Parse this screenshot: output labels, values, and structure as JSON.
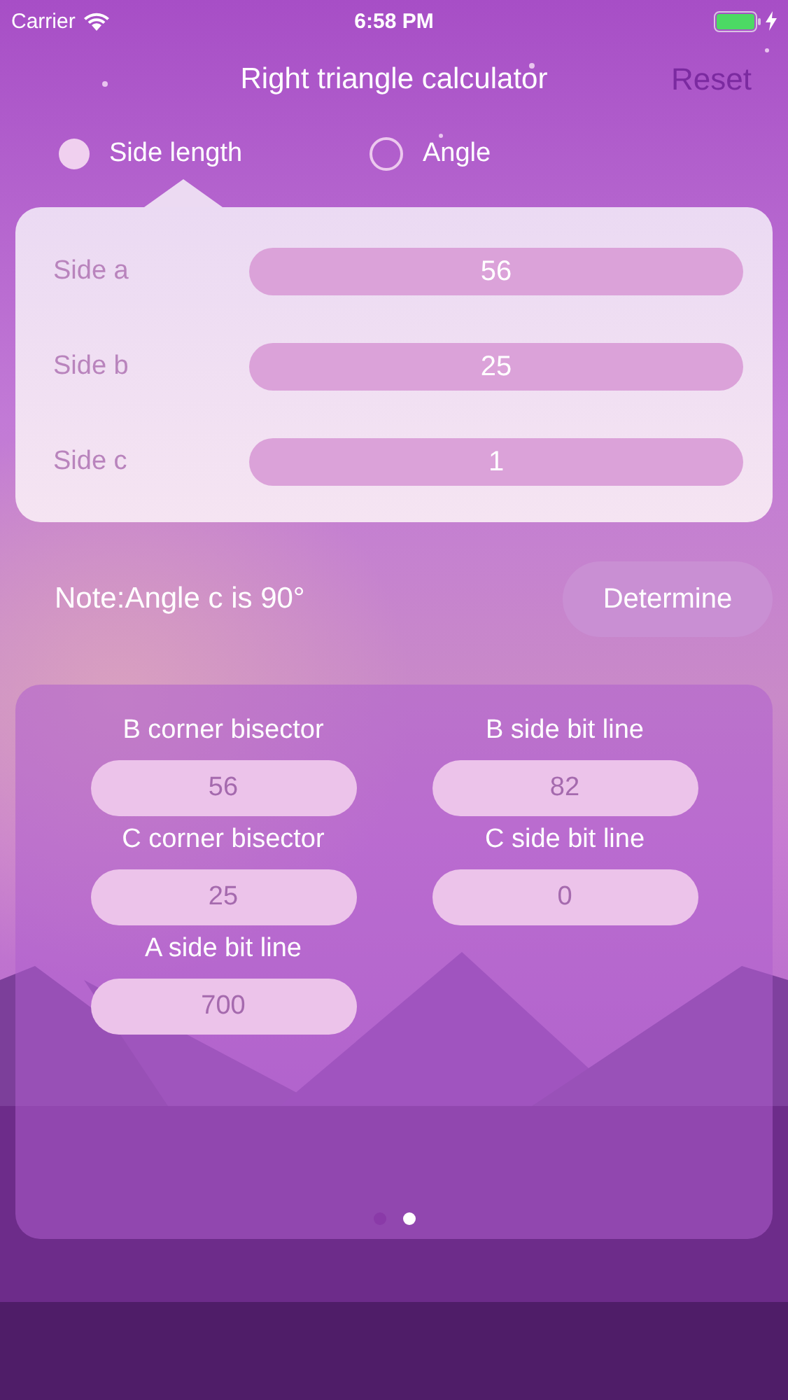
{
  "status_bar": {
    "carrier": "Carrier",
    "time": "6:58 PM"
  },
  "nav": {
    "title": "Right triangle calculator",
    "action": "Reset"
  },
  "modes": [
    {
      "label": "Side length",
      "selected": true
    },
    {
      "label": "Angle",
      "selected": false
    }
  ],
  "inputs": [
    {
      "label": "Side a",
      "value": "56"
    },
    {
      "label": "Side b",
      "value": "25"
    },
    {
      "label": "Side c",
      "value": "1"
    }
  ],
  "note": "Note:Angle c is 90°",
  "determine_button": "Determine",
  "results": [
    {
      "label": "B corner bisector",
      "value": "56"
    },
    {
      "label": "B side bit line",
      "value": "82"
    },
    {
      "label": "C corner bisector",
      "value": "25"
    },
    {
      "label": "C side bit line",
      "value": "0"
    },
    {
      "label": "A side bit line",
      "value": "700"
    }
  ],
  "pages": [
    {
      "selected": false
    },
    {
      "selected": true
    }
  ]
}
